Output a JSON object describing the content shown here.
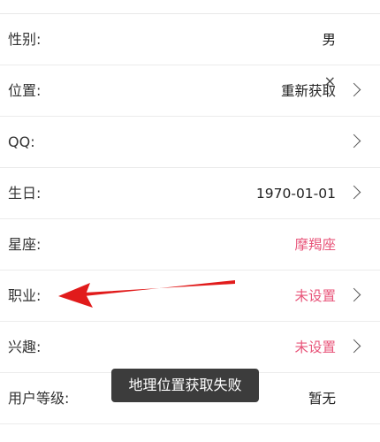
{
  "rows": [
    {
      "label": "性别:",
      "value": "男"
    },
    {
      "label": "位置:",
      "value": "重新获取",
      "close": "×"
    },
    {
      "label": "QQ:",
      "value": ""
    },
    {
      "label": "生日:",
      "value": "1970-01-01"
    },
    {
      "label": "星座:",
      "value": "摩羯座"
    },
    {
      "label": "职业:",
      "value": "未设置"
    },
    {
      "label": "兴趣:",
      "value": "未设置"
    },
    {
      "label": "用户等级:",
      "value": "暂无"
    }
  ],
  "toast": {
    "text": "地理位置获取失败"
  },
  "colors": {
    "accent_pink": "#e8557a",
    "annotation_red": "#e11b1b",
    "toast_bg": "#3c3c3c"
  },
  "icons": {
    "chevron": "chevron-right-icon",
    "close": "close-icon",
    "arrow": "red-arrow-annotation"
  }
}
